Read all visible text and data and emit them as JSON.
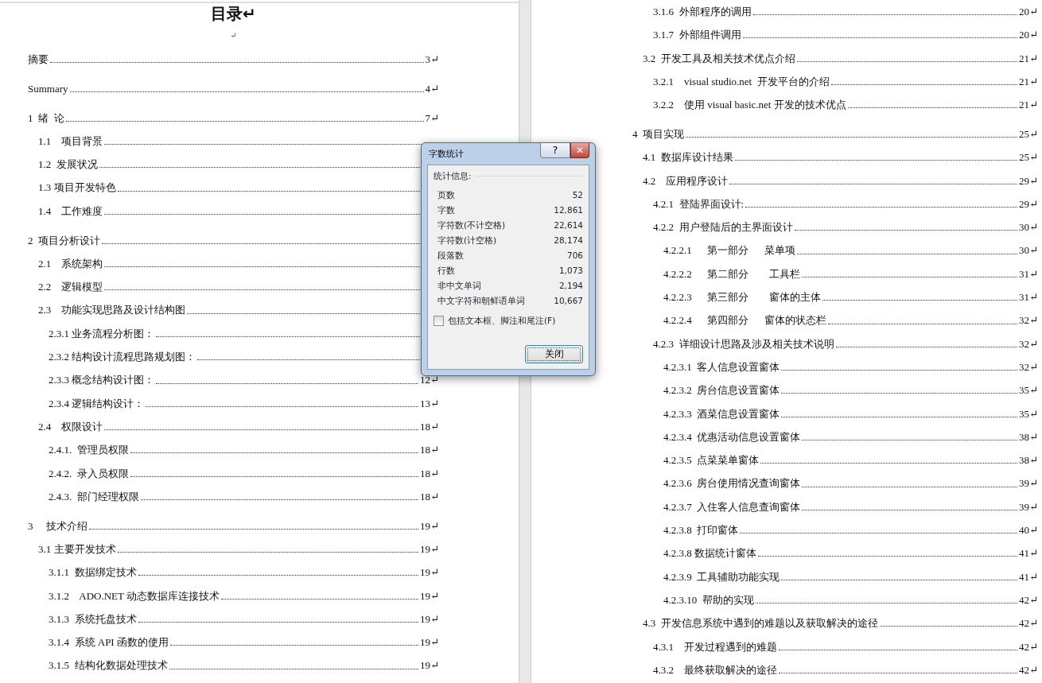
{
  "document": {
    "pages": [
      {
        "title": "目录↵",
        "blank_line": "↵",
        "entries": [
          {
            "text": "摘要",
            "page": "3↵"
          },
          {
            "text": "Summary",
            "page": "4↵"
          },
          {
            "text": "1  绪  论",
            "page": "7↵",
            "children": [
              {
                "text": "1.1    项目背景"
              },
              {
                "text": "1.2  发展状况"
              },
              {
                "text": "1.3 项目开发特色"
              },
              {
                "text": "1.4    工作难度"
              }
            ]
          },
          {
            "text": "2  项目分析设计",
            "children": [
              {
                "text": "2.1    系统架构"
              },
              {
                "text": "2.2    逻辑模型"
              },
              {
                "text": "2.3    功能实现思路及设计结构图",
                "children": [
                  {
                    "text": "2.3.1 业务流程分析图："
                  },
                  {
                    "text": "2.3.2 结构设计流程思路规划图："
                  },
                  {
                    "text": "2.3.3 概念结构设计图：",
                    "page": "12↵"
                  },
                  {
                    "text": "2.3.4 逻辑结构设计：",
                    "page": "13↵"
                  }
                ]
              },
              {
                "text": "2.4    权限设计",
                "page": "18↵",
                "children": [
                  {
                    "text": "2.4.1.  管理员权限",
                    "page": "18↵"
                  },
                  {
                    "text": "2.4.2.  录入员权限",
                    "page": "18↵"
                  },
                  {
                    "text": "2.4.3.  部门经理权限",
                    "page": "18↵"
                  }
                ]
              }
            ]
          },
          {
            "text": "3     技术介绍",
            "page": "19↵",
            "children": [
              {
                "text": "3.1 主要开发技术",
                "page": "19↵",
                "children": [
                  {
                    "text": "3.1.1  数据绑定技术",
                    "page": "19↵"
                  },
                  {
                    "text": "3.1.2    ADO.NET 动态数据库连接技术",
                    "page": "19↵"
                  },
                  {
                    "text": "3.1.3  系统托盘技术",
                    "page": "19↵"
                  },
                  {
                    "text": "3.1.4  系统 API 函数的使用",
                    "page": "19↵"
                  },
                  {
                    "text": "3.1.5  结构化数据处理技术",
                    "page": "19↵"
                  }
                ]
              }
            ]
          }
        ]
      },
      {
        "entries": [
          {
            "children": [
              {
                "children": [
                  {
                    "text": "3.1.6  外部程序的调用",
                    "page": "20↵"
                  },
                  {
                    "text": "3.1.7  外部组件调用",
                    "page": "20↵"
                  }
                ]
              },
              {
                "text": "3.2  开发工具及相关技术优点介绍",
                "page": "21↵",
                "children": [
                  {
                    "text": "3.2.1    visual studio.net  开发平台的介绍",
                    "page": "21↵"
                  },
                  {
                    "text": "3.2.2    使用 visual basic.net 开发的技术优点",
                    "page": "21↵"
                  }
                ]
              }
            ]
          },
          {
            "text": "4  项目实现",
            "page": "25↵",
            "children": [
              {
                "text": "4.1  数据库设计结果",
                "page": "25↵"
              },
              {
                "text": "4.2    应用程序设计",
                "page": "29↵",
                "children": [
                  {
                    "text": "4.2.1  登陆界面设计:",
                    "page": "29↵"
                  },
                  {
                    "text": "4.2.2  用户登陆后的主界面设计",
                    "page": "30↵",
                    "children": [
                      {
                        "text": "4.2.2.1      第一部分      菜单项",
                        "page": "30↵"
                      },
                      {
                        "text": "4.2.2.2      第二部分        工具栏",
                        "page": "31↵"
                      },
                      {
                        "text": "4.2.2.3      第三部分        窗体的主体",
                        "page": "31↵"
                      },
                      {
                        "text": "4.2.2.4      第四部分      窗体的状态栏",
                        "page": "32↵"
                      }
                    ]
                  },
                  {
                    "text": "4.2.3  详细设计思路及涉及相关技术说明",
                    "page": "32↵",
                    "children": [
                      {
                        "text": "4.2.3.1  客人信息设置窗体",
                        "page": "32↵"
                      },
                      {
                        "text": "4.2.3.2  房台信息设置窗体",
                        "page": "35↵"
                      },
                      {
                        "text": "4.2.3.3  酒菜信息设置窗体",
                        "page": "35↵"
                      },
                      {
                        "text": "4.2.3.4  优惠活动信息设置窗体",
                        "page": "38↵"
                      },
                      {
                        "text": "4.2.3.5  点菜菜单窗体",
                        "page": "38↵"
                      },
                      {
                        "text": "4.2.3.6  房台使用情况查询窗体",
                        "page": "39↵"
                      },
                      {
                        "text": "4.2.3.7  入住客人信息查询窗体",
                        "page": "39↵"
                      },
                      {
                        "text": "4.2.3.8  打印窗体",
                        "page": "40↵"
                      },
                      {
                        "text": "4.2.3.8 数据统计窗体",
                        "page": "41↵"
                      },
                      {
                        "text": "4.2.3.9  工具辅助功能实现",
                        "page": "41↵"
                      },
                      {
                        "text": "4.2.3.10  帮助的实现",
                        "page": "42↵"
                      }
                    ]
                  }
                ]
              },
              {
                "text": "4.3  开发信息系统中遇到的难题以及获取解决的途径",
                "page": "42↵",
                "children": [
                  {
                    "text": "4.3.1    开发过程遇到的难题",
                    "page": "42↵"
                  },
                  {
                    "text": "4.3.2    最终获取解决的途径",
                    "page": "42↵"
                  }
                ]
              }
            ]
          }
        ]
      }
    ]
  },
  "dialog": {
    "title": "字数统计",
    "help_button": "?",
    "close_icon": "✕",
    "group_label": "统计信息:",
    "stats": [
      {
        "label": "页数",
        "value": "52"
      },
      {
        "label": "字数",
        "value": "12,861"
      },
      {
        "label": "字符数(不计空格)",
        "value": "22,614"
      },
      {
        "label": "字符数(计空格)",
        "value": "28,174"
      },
      {
        "label": "段落数",
        "value": "706"
      },
      {
        "label": "行数",
        "value": "1,073"
      },
      {
        "label": "非中文单词",
        "value": "2,194"
      },
      {
        "label": "中文字符和朝鲜语单词",
        "value": "10,667"
      }
    ],
    "checkbox": {
      "label": "包括文本框、脚注和尾注(F)",
      "checked": false
    },
    "close_button": "关闭"
  }
}
